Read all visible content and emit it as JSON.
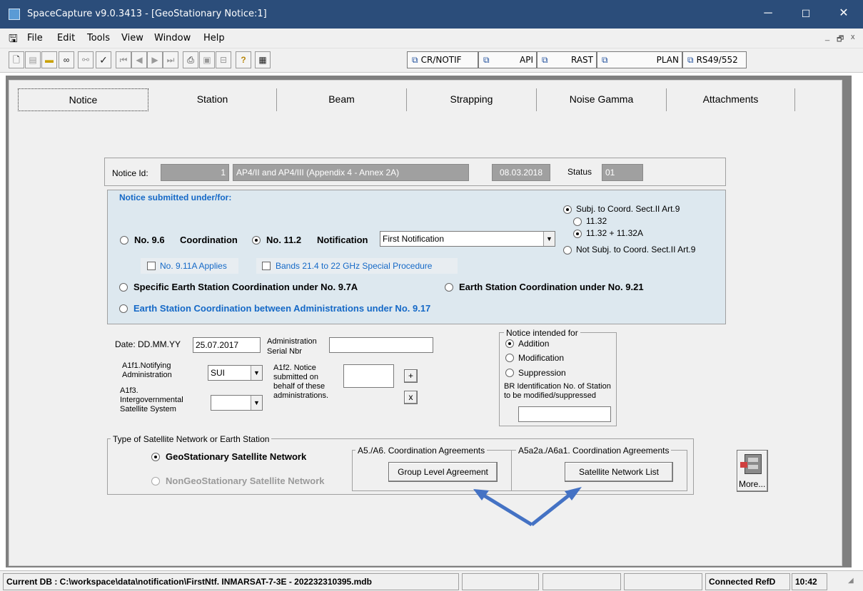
{
  "window": {
    "title": "SpaceCapture v9.0.3413 - [GeoStationary Notice:1]",
    "controls": {
      "minimize": "─",
      "maximize": "☐",
      "close": "✕"
    }
  },
  "menu": {
    "items": [
      "File",
      "Edit",
      "Tools",
      "View",
      "Window",
      "Help"
    ]
  },
  "mdi_controls": {
    "minimize": "_",
    "restore": "🗗",
    "close": "x"
  },
  "toolbar": {
    "mode_tabs": [
      "CR/NOTIF",
      "API",
      "RAST",
      "PLAN",
      "RS49/552"
    ]
  },
  "tabs": [
    "Notice",
    "Station",
    "Beam",
    "Strapping",
    "Noise Gamma",
    "Attachments"
  ],
  "header": {
    "notice_id_label": "Notice Id:",
    "notice_id_value": "1",
    "notice_type": "AP4/II and AP4/III (Appendix 4 - Annex 2A)",
    "date": "08.03.2018",
    "status_label": "Status",
    "status_value": "01"
  },
  "submitted": {
    "title": "Notice submitted under/for:",
    "coord_96_num": "No. 9.6",
    "coord_96_label": "Coordination",
    "notif_112_num": "No. 11.2",
    "notif_112_label": "Notification",
    "notif_select": "First Notification",
    "subj_coord": "Subj. to Coord. Sect.II Art.9",
    "opt_1132": "11.32",
    "opt_1132a": "11.32 + 11.32A",
    "not_subj": "Not Subj. to Coord. Sect.II Art.9",
    "chk_911a": "No. 9.11A Applies",
    "chk_bands": "Bands 21.4 to 22 GHz Special Procedure",
    "specific_es": "Specific Earth Station Coordination under No. 9.7A",
    "es_921": "Earth Station Coordination under No. 9.21",
    "es_917": "Earth Station Coordination between Administrations under No. 9.17"
  },
  "form": {
    "date_label": "Date: DD.MM.YY",
    "date_value": "25.07.2017",
    "admin_serial_label_1": "Administration",
    "admin_serial_label_2": "Serial Nbr",
    "admin_serial_value": "",
    "a1f1_label_1": "A1f1.Notifying",
    "a1f1_label_2": "Administration",
    "a1f1_value": "SUI",
    "a1f2_label_1": "A1f2. Notice",
    "a1f2_label_2": "submitted on",
    "a1f2_label_3": "behalf of these",
    "a1f2_label_4": "administrations.",
    "add_btn": "+",
    "remove_btn": "x",
    "a1f3_label_1": "A1f3.",
    "a1f3_label_2": "Intergovernmental",
    "a1f3_label_3": "Satellite System",
    "a1f3_value": ""
  },
  "intended": {
    "title": "Notice intended for",
    "addition": "Addition",
    "modification": "Modification",
    "suppression": "Suppression",
    "br_label_1": "BR Identification No. of Station",
    "br_label_2": "to be modified/suppressed",
    "br_value": ""
  },
  "network_type": {
    "title": "Type of Satellite Network or Earth Station",
    "geo": "GeoStationary Satellite Network",
    "nongeo": "NonGeoStationary Satellite Network",
    "a5a6_title": "A5./A6. Coordination Agreements",
    "group_btn": "Group Level Agreement",
    "a5a2a_title": "A5a2a./A6a1. Coordination Agreements",
    "satlist_btn": "Satellite Network List"
  },
  "more_btn": "More...",
  "statusbar": {
    "db": "Current DB : C:\\workspace\\data\\notification\\FirstNtf. INMARSAT-7-3E - 202232310395.mdb",
    "connected": "Connected RefD",
    "time": "10:42"
  },
  "colors": {
    "titlebar": "#2b4d7a",
    "accent_blue": "#1569c7",
    "panel_blue": "#dde8ef",
    "arrow": "#4472c4"
  }
}
